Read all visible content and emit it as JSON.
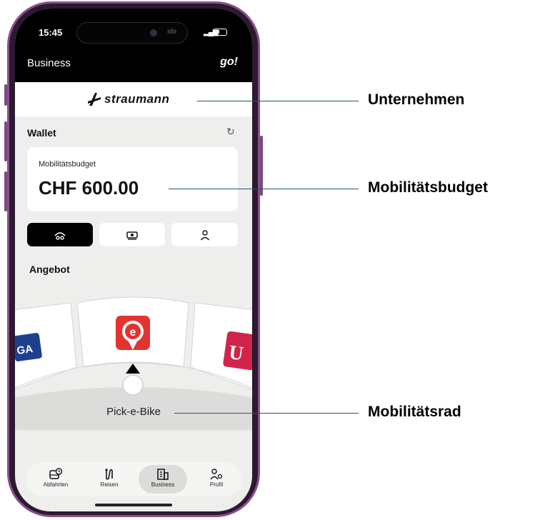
{
  "status_bar": {
    "time": "15:45"
  },
  "header": {
    "title": "Business",
    "logo_text": "go!"
  },
  "company": {
    "name": "straumann"
  },
  "wallet": {
    "title": "Wallet",
    "budget_label": "Mobilitätsbudget",
    "budget_value": "CHF 600.00"
  },
  "segments": [
    {
      "icon": "sharing-vehicle-icon",
      "active": true
    },
    {
      "icon": "money-icon",
      "active": false
    },
    {
      "icon": "person-icon",
      "active": false
    }
  ],
  "offers": {
    "title": "Angebot",
    "wheel_items": [
      {
        "label": "GA",
        "icon": "ga-icon",
        "color": "#1f3f8f"
      },
      {
        "label": "e",
        "icon": "pick-e-bike-icon",
        "color": "#e2332f"
      },
      {
        "label": "U",
        "icon": "u-icon",
        "color": "#d2234a"
      }
    ],
    "selected_label": "Pick-e-Bike"
  },
  "bottom_nav": [
    {
      "label": "Abfahrten",
      "icon": "bus-clock-icon",
      "active": false
    },
    {
      "label": "Reisen",
      "icon": "route-icon",
      "active": false
    },
    {
      "label": "Business",
      "icon": "building-icon",
      "active": true
    },
    {
      "label": "Profil",
      "icon": "profile-settings-icon",
      "active": false
    }
  ],
  "annotations": {
    "company": "Unternehmen",
    "budget": "Mobilitätsbudget",
    "wheel": "Mobilitätsrad"
  },
  "colors": {
    "accent": "#e2332f",
    "callout_line": "#1d5c6e"
  }
}
